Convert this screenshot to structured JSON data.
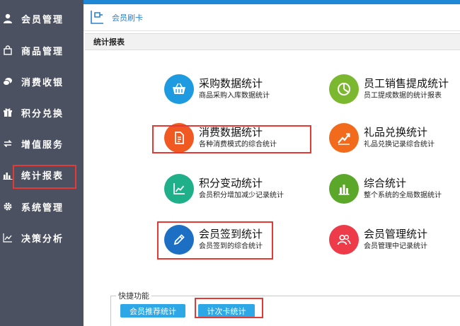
{
  "sidebar": {
    "items": [
      {
        "label": "会员管理",
        "icon": "user-icon"
      },
      {
        "label": "商品管理",
        "icon": "bag-icon"
      },
      {
        "label": "消费收银",
        "icon": "coin-icon"
      },
      {
        "label": "积分兑换",
        "icon": "gift-icon"
      },
      {
        "label": "增值服务",
        "icon": "exchange-icon"
      },
      {
        "label": "统计报表",
        "icon": "bar-chart-icon"
      },
      {
        "label": "系统管理",
        "icon": "gear-icon"
      },
      {
        "label": "决策分析",
        "icon": "line-chart-icon"
      }
    ],
    "active": "统计报表"
  },
  "header": {
    "title": "会员刷卡"
  },
  "panel": {
    "title": "统计报表"
  },
  "reports": [
    {
      "name": "采购数据统计",
      "desc": "商品采购入库数据统计",
      "icon": "basket-icon",
      "color": "#1e9be0"
    },
    {
      "name": "员工销售提成统计",
      "desc": "员工提成数据的统计报表",
      "icon": "pie-chart-icon",
      "color": "#7cb82f"
    },
    {
      "name": "消费数据统计",
      "desc": "各种消费模式的综合统计",
      "icon": "document-icon",
      "color": "#f05a22"
    },
    {
      "name": "礼品兑换统计",
      "desc": "礼品兑换记录综合统计",
      "icon": "trend-up-icon",
      "color": "#f26b1d"
    },
    {
      "name": "积分变动统计",
      "desc": "会员积分增加减少记录统计",
      "icon": "line-chart-icon",
      "color": "#1fb08a"
    },
    {
      "name": "综合统计",
      "desc": "整个系统的全局数据统计",
      "icon": "bar-chart-icon",
      "color": "#5aa72a"
    },
    {
      "name": "会员签到统计",
      "desc": "会员签到的综合统计",
      "icon": "pencil-icon",
      "color": "#1d6fc4"
    },
    {
      "name": "会员管理统计",
      "desc": "会员管理中记录统计",
      "icon": "users-icon",
      "color": "#ee3b4a"
    }
  ],
  "quick": {
    "legend": "快捷功能",
    "buttons": [
      "会员推荐统计",
      "计次卡统计"
    ]
  },
  "colors": {
    "sidebar_bg": "#4b5160",
    "accent": "#1e88d6",
    "highlight": "#e53935",
    "quick_button": "#2ea7e6"
  }
}
